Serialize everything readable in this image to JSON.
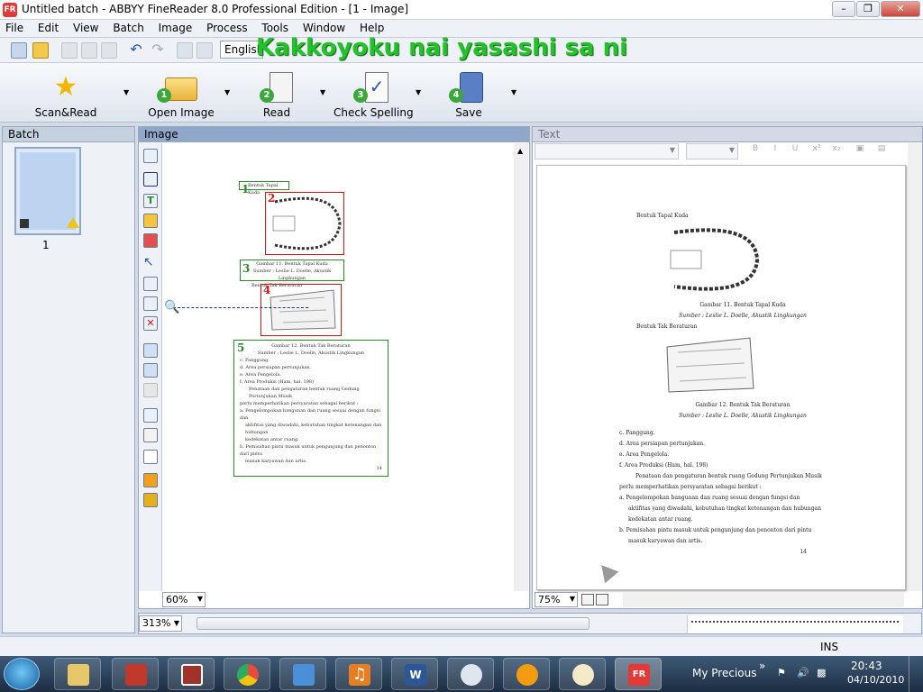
{
  "window": {
    "title": "Untitled batch - ABBYY FineReader 8.0 Professional Edition - [1 - Image]",
    "app_icon": "FR"
  },
  "menu": [
    "File",
    "Edit",
    "View",
    "Batch",
    "Image",
    "Process",
    "Tools",
    "Window",
    "Help"
  ],
  "toolbar": {
    "language": "English",
    "overlay_caption": "Kakkoyoku nai yasashi sa ni"
  },
  "big_buttons": [
    {
      "label": "Scan&Read",
      "number": ""
    },
    {
      "label": "Open Image",
      "number": "1"
    },
    {
      "label": "Read",
      "number": "2"
    },
    {
      "label": "Check Spelling",
      "number": "3"
    },
    {
      "label": "Save",
      "number": "4"
    }
  ],
  "panes": {
    "batch": "Batch",
    "image": "Image",
    "text": "Text"
  },
  "batch": {
    "page_number": "1"
  },
  "image_zoom": "60%",
  "text_zoom": "75%",
  "bottom_zoom": "313%",
  "status": {
    "mode": "INS"
  },
  "blocks": [
    "1",
    "2",
    "3",
    "4",
    "5"
  ],
  "document": {
    "item1": "Bentuk Tapal Kuda",
    "caption1": "Gambar 11. Bentuk Tapal Kuda",
    "source1": "Sumber : Leslie L. Doelle, Akustik Lingkungan",
    "item2": "Bentuk Tak Beraturan",
    "caption2": "Gambar 12. Bentuk Tak Beraturan",
    "source2": "Sumber : Leslie L. Doelle, Akustik Lingkungan",
    "list_c": "c.   Panggung.",
    "list_d": "d.   Area persiapan pertunjukan.",
    "list_e": "e.   Area Pengelola.",
    "list_f": "f.    Area Produksi (Ham, hal. 198)",
    "para1": "Penataan dan pengaturan bentuk ruang Gedung Pertunjukan Musik",
    "para2": "perlu memperhatikan persyaratan sebagai berikut :",
    "list_a1": "a.   Pengelompokan bangunan dan ruang sesuai dengan fungsi dan",
    "list_a2": "aktifitas yang diwadahi, kebutuhan tingkat ketenangan dan hubungan",
    "list_a3": "kedekatan antar ruang.",
    "list_b1": "b.   Pemisahan pintu masuk untuk pengunjung dan penonton dari pintu",
    "list_b2": "masuk karyawan dan artis.",
    "page_no": "14"
  },
  "taskbar": {
    "clock_time": "20:43",
    "clock_date": "04/10/2010",
    "tray_label": "My Precious",
    "tray_chevron": "»"
  }
}
